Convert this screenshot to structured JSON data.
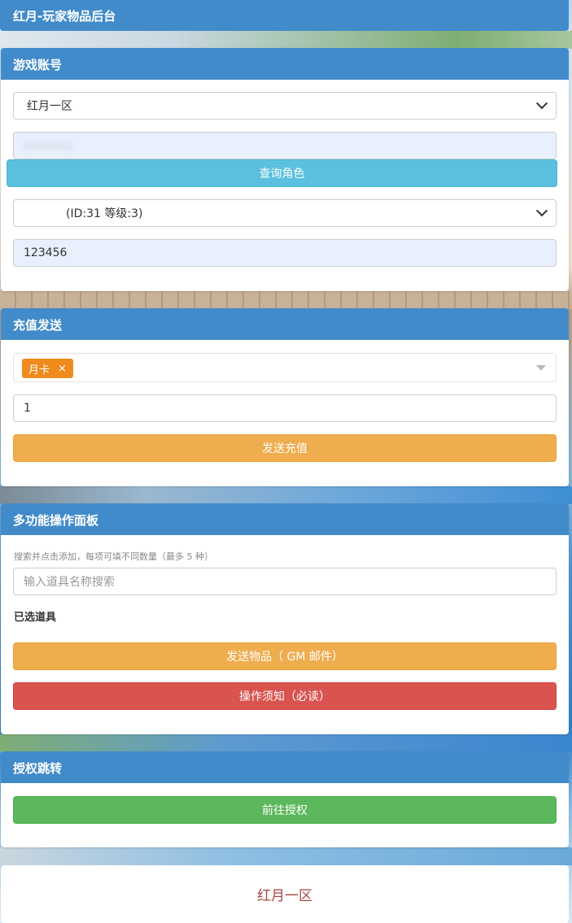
{
  "app": {
    "title": "红月-玩家物品后台"
  },
  "account_panel": {
    "title": "游戏账号",
    "server_select": {
      "value": "红月一区"
    },
    "account_input": {
      "value": ""
    },
    "query_button": "查询角色",
    "role_select": {
      "value": "(ID:31 等级:3)"
    },
    "password_input": {
      "value": "123456"
    }
  },
  "recharge_panel": {
    "title": "充值发送",
    "selected_tag": "月卡",
    "tag_remove": "×",
    "quantity_input": {
      "value": "1"
    },
    "send_button": "发送充值"
  },
  "multi_panel": {
    "title": "多功能操作面板",
    "hint": "搜索并点击添加，每项可填不同数量（最多 5 种）",
    "search_input": {
      "placeholder": "输入道具名称搜索"
    },
    "selected_label": "已选道具",
    "send_items_button": "发送物品（ GM 邮件）",
    "notice_button": "操作须知（必读）"
  },
  "auth_panel": {
    "title": "授权跳转",
    "go_button": "前往授权"
  },
  "footer": {
    "server_name": "红月一区"
  },
  "colors": {
    "header_blue": "#428bca",
    "info": "#5bc0de",
    "warning": "#f0ad4e",
    "danger": "#d9534f",
    "success": "#5cb85c",
    "tag_orange": "#ef8a1d",
    "footer_text": "#a94442"
  }
}
